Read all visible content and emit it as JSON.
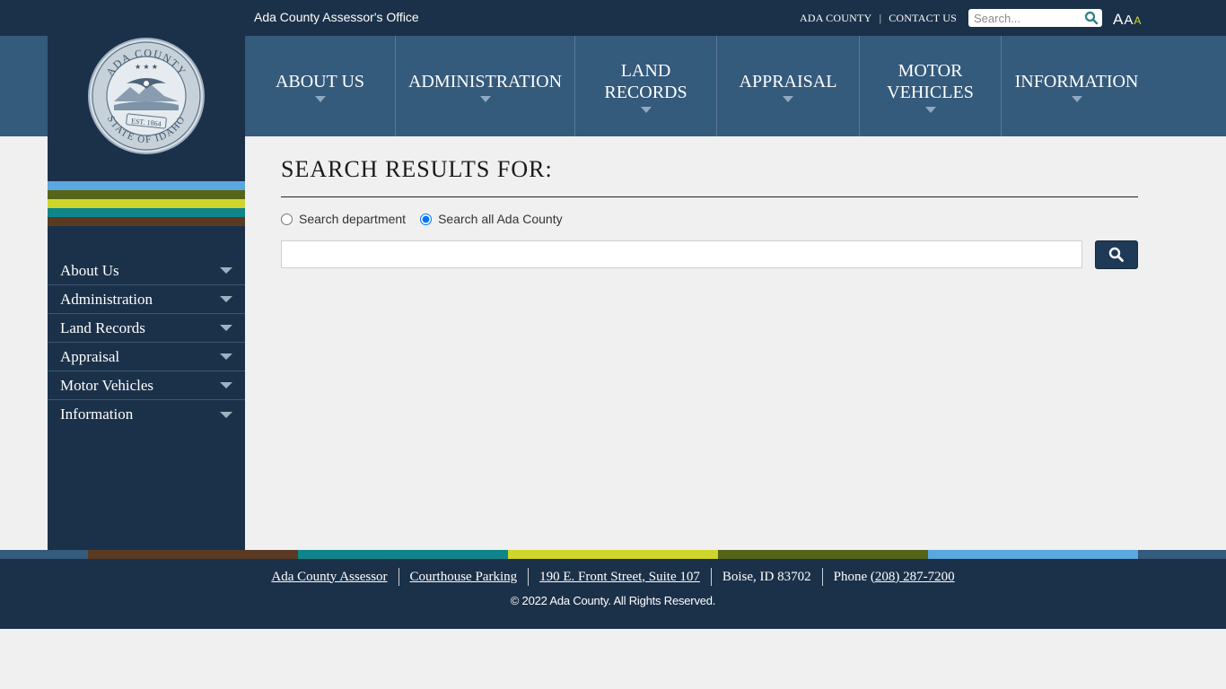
{
  "topbar": {
    "office_name": "Ada County Assessor's Office",
    "links": [
      "ADA COUNTY",
      "CONTACT US"
    ],
    "search_placeholder": "Search...",
    "font_sizes": [
      "A",
      "A",
      "A"
    ]
  },
  "seal": {
    "top_text": "ADA COUNTY",
    "bottom_text": "STATE OF IDAHO",
    "est": "EST. 1864"
  },
  "mainnav": {
    "items": [
      {
        "label": "ABOUT US"
      },
      {
        "label": "ADMINISTRATION"
      },
      {
        "label": "LAND RECORDS"
      },
      {
        "label": "APPRAISAL"
      },
      {
        "label": "MOTOR VEHICLES"
      },
      {
        "label": "INFORMATION"
      }
    ]
  },
  "sidebar": {
    "items": [
      {
        "label": "About Us"
      },
      {
        "label": "Administration"
      },
      {
        "label": "Land Records"
      },
      {
        "label": "Appraisal"
      },
      {
        "label": "Motor Vehicles"
      },
      {
        "label": "Information"
      }
    ]
  },
  "main": {
    "heading": "SEARCH RESULTS FOR:",
    "radio_department": "Search department",
    "radio_all": "Search all Ada County",
    "selected_scope": "Search all Ada County",
    "search_value": ""
  },
  "footer": {
    "links": [
      "Ada County Assessor",
      "Courthouse Parking",
      "190 E. Front Street, Suite 107"
    ],
    "city": "Boise, ID 83702",
    "phone_label": "Phone",
    "phone_number": "(208) 287-7200",
    "copyright": "© 2022 Ada County. All Rights Reserved."
  },
  "colors": {
    "navy": "#1b3149",
    "nav_blue": "#345a7c",
    "stripe_light_blue": "#5ba7e0",
    "stripe_olive": "#556417",
    "stripe_yellow": "#d0d52b",
    "stripe_teal": "#0f8589",
    "stripe_brown": "#5a3a22",
    "accent_yellow": "#d6dc2c"
  }
}
